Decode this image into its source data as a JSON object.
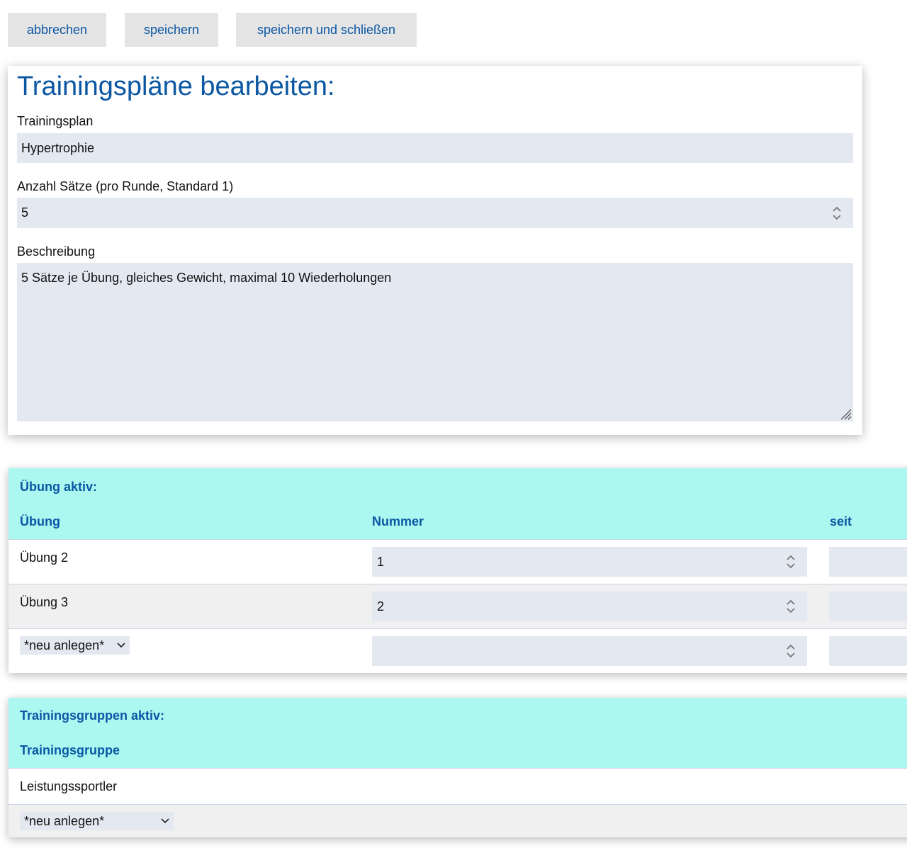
{
  "toolbar": {
    "cancel_label": "abbrechen",
    "save_label": "speichern",
    "save_close_label": "speichern und schließen"
  },
  "form": {
    "title": "Trainingspläne bearbeiten:",
    "plan_label": "Trainingsplan",
    "plan_value": "Hypertrophie",
    "sets_label": "Anzahl Sätze (pro Runde, Standard 1)",
    "sets_value": "5",
    "description_label": "Beschreibung",
    "description_value": "5 Sätze je Übung, gleiches Gewicht, maximal 10 Wiederholungen"
  },
  "exercises": {
    "title": "Übung aktiv:",
    "columns": [
      "Übung",
      "Nummer",
      "seit"
    ],
    "rows": [
      {
        "name": "Übung 2",
        "number": "1",
        "since": ""
      },
      {
        "name": "Übung 3",
        "number": "2",
        "since": ""
      }
    ],
    "new_select": "*neu anlegen*",
    "new_number": ""
  },
  "groups": {
    "title": "Trainingsgruppen aktiv:",
    "column": "Trainingsgruppe",
    "rows": [
      {
        "name": "Leistungssportler"
      }
    ],
    "new_select": "*neu anlegen*"
  },
  "colors": {
    "accent": "#0b57a4",
    "header_bg": "#abf8f1",
    "field_bg": "#e4e8f0",
    "button_bg": "#e4e4e4"
  },
  "icons": {
    "spinner": "spinner-arrows-icon",
    "dropdown": "chevron-down-icon",
    "resize": "resize-handle-icon"
  }
}
